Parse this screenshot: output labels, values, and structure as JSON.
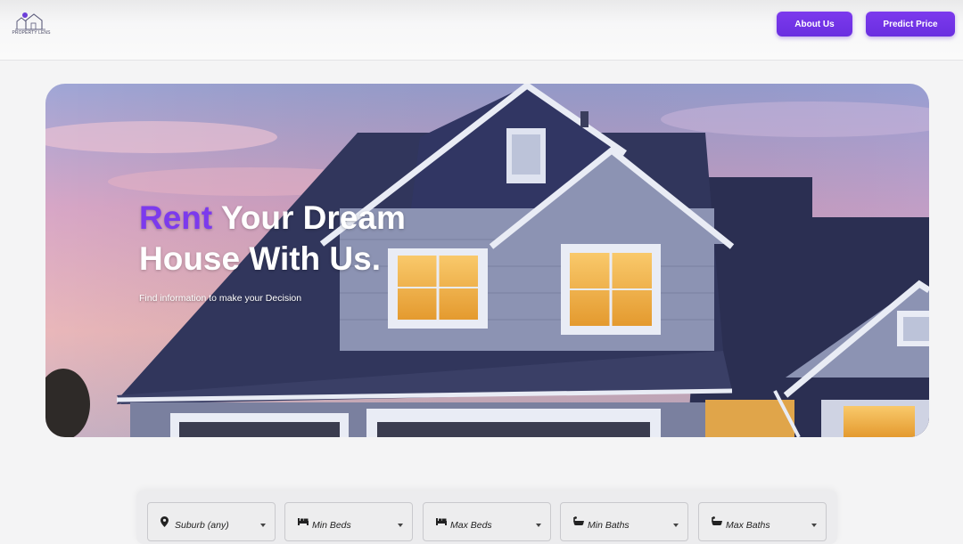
{
  "header": {
    "logo_text": "PROPERTY LENS",
    "nav": [
      {
        "label": "About Us"
      },
      {
        "label": "Predict Price"
      }
    ]
  },
  "hero": {
    "title_accent": "Rent",
    "title_rest_line1": "Your Dream",
    "title_line2": "House With Us.",
    "subtitle": "Find information to make your Decision"
  },
  "filters": [
    {
      "label": "Suburb (any)",
      "icon": "map-pin-icon"
    },
    {
      "label": "Min Beds",
      "icon": "bed-icon"
    },
    {
      "label": "Max Beds",
      "icon": "bed-icon"
    },
    {
      "label": "Min Baths",
      "icon": "bathtub-icon"
    },
    {
      "label": "Max Baths",
      "icon": "bathtub-icon"
    }
  ],
  "colors": {
    "accent": "#7c3aed",
    "button_bg": "#6d2fe3",
    "hero_text": "#ffffff"
  }
}
